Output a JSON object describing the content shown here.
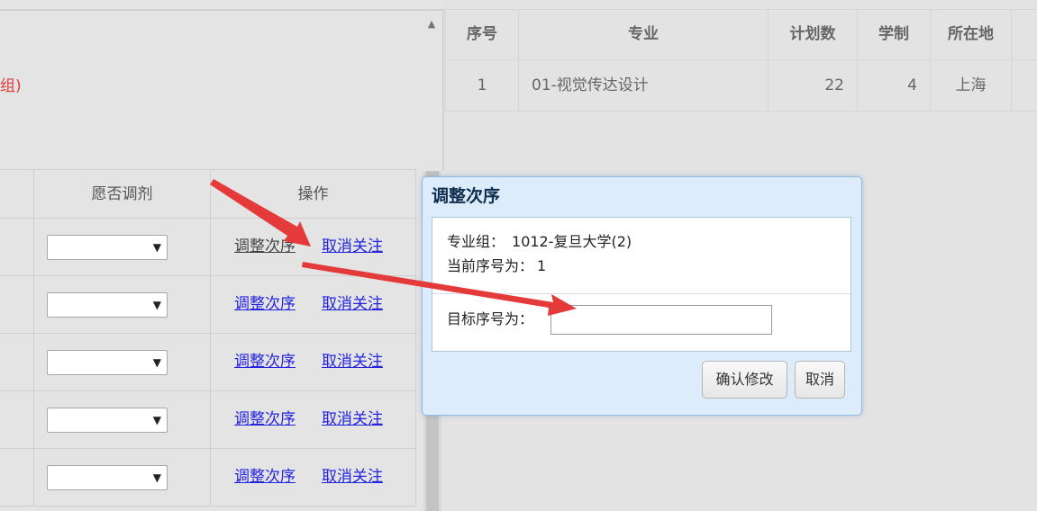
{
  "left_panel": {
    "group_suffix": "组)",
    "table": {
      "headers": [
        "",
        "愿否调剂",
        "操作"
      ],
      "rows": [
        {
          "adjust_label": "调整次序",
          "cancel_label": "取消关注"
        },
        {
          "adjust_label": "调整次序",
          "cancel_label": "取消关注"
        },
        {
          "adjust_label": "调整次序",
          "cancel_label": "取消关注"
        },
        {
          "adjust_label": "调整次序",
          "cancel_label": "取消关注"
        },
        {
          "adjust_label": "调整次序",
          "cancel_label": "取消关注"
        }
      ]
    }
  },
  "right_table": {
    "headers": [
      "序号",
      "专业",
      "计划数",
      "学制",
      "所在地",
      ""
    ],
    "rows": [
      {
        "index": "1",
        "major": "01-视觉传达设计",
        "plan": "22",
        "years": "4",
        "location": "上海",
        "extra": ""
      }
    ]
  },
  "dialog": {
    "title": "调整次序",
    "group_label": "专业组：",
    "group_value": "1012-复旦大学(2)",
    "current_label": "当前序号为：",
    "current_value": "1",
    "target_label": "目标序号为：",
    "target_value": "",
    "confirm_label": "确认修改",
    "cancel_label": "取消"
  },
  "icons": {
    "scroll_up": "scroll-up-arrow-icon",
    "select_arrow": "triangle-down-icon"
  },
  "colors": {
    "link": "#2323e0",
    "annotation_arrow": "#e53a3a",
    "dialog_title": "#0e2d4f",
    "warning_text": "#e33b3b"
  }
}
